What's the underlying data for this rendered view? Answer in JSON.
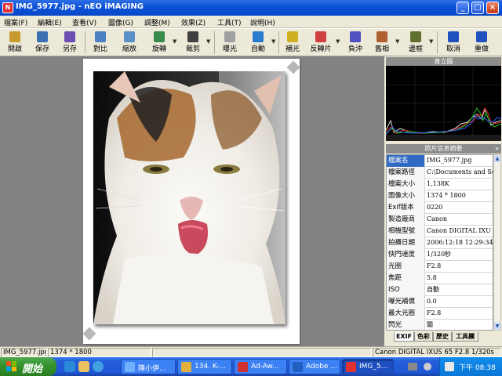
{
  "window": {
    "title": "IMG_5977.jpg - nEO iMAGING",
    "app_icon": "N"
  },
  "menu": [
    {
      "label": "檔案(F)"
    },
    {
      "label": "編輯(E)"
    },
    {
      "label": "查看(V)"
    },
    {
      "label": "圖像(G)"
    },
    {
      "label": "調整(M)"
    },
    {
      "label": "效果(Z)"
    },
    {
      "label": "工具(T)"
    },
    {
      "label": "說明(H)"
    }
  ],
  "toolbar": [
    {
      "label": "開啟",
      "icon": "open-folder-icon",
      "color": "#c89b2e"
    },
    {
      "label": "保存",
      "icon": "save-disk-icon",
      "color": "#3a6fb0"
    },
    {
      "label": "另存",
      "icon": "save-as-icon",
      "color": "#6a4fb0"
    },
    {
      "label": "對比",
      "icon": "compare-icon",
      "color": "#4a80c0"
    },
    {
      "label": "縮放",
      "icon": "resize-icon",
      "color": "#5a90c8"
    },
    {
      "label": "旋轉",
      "icon": "rotate-icon",
      "color": "#3a8a4a"
    },
    {
      "label": "裁剪",
      "icon": "crop-icon",
      "color": "#404040"
    },
    {
      "label": "曝光",
      "icon": "exposure-icon",
      "color": "#a0a0a0"
    },
    {
      "label": "自動",
      "icon": "auto-fix-icon",
      "color": "#2a7ad0"
    },
    {
      "label": "補光",
      "icon": "fill-light-icon",
      "color": "#d0b020"
    },
    {
      "label": "反轉片",
      "icon": "slide-film-icon",
      "color": "#d04040"
    },
    {
      "label": "負沖",
      "icon": "cross-process-icon",
      "color": "#5050c0"
    },
    {
      "label": "舊相",
      "icon": "old-photo-icon",
      "color": "#b06030"
    },
    {
      "label": "邊框",
      "icon": "frame-icon",
      "color": "#607030"
    },
    {
      "label": "取消",
      "icon": "undo-icon",
      "color": "#2050c0"
    },
    {
      "label": "重做",
      "icon": "redo-icon",
      "color": "#2050c0"
    }
  ],
  "panel": {
    "histogram_title": "直立圖",
    "info_title": "照片信息摘要",
    "rows": [
      {
        "key": "檔案名",
        "value": "IMG_5977.jpg"
      },
      {
        "key": "檔案路徑",
        "value": "C:\\Documents and Set"
      },
      {
        "key": "檔案大小",
        "value": "1,138K"
      },
      {
        "key": "圖像大小",
        "value": "1374 * 1800"
      },
      {
        "key": "Exif版本",
        "value": "0220"
      },
      {
        "key": "製造廠商",
        "value": "Canon"
      },
      {
        "key": "相機型號",
        "value": "Canon DIGITAL IXU"
      },
      {
        "key": "拍攝日期",
        "value": "2006:12:18 12:29:34"
      },
      {
        "key": "快門速度",
        "value": "1/320秒"
      },
      {
        "key": "光圈",
        "value": "F2.8"
      },
      {
        "key": "焦距",
        "value": "5.8"
      },
      {
        "key": "ISO",
        "value": "自動"
      },
      {
        "key": "曝光補償",
        "value": "0.0"
      },
      {
        "key": "最大光圈",
        "value": "F2.8"
      },
      {
        "key": "閃光",
        "value": "關"
      }
    ],
    "tabs": [
      {
        "label": "EXIF"
      },
      {
        "label": "色彩"
      },
      {
        "label": "歷史"
      },
      {
        "label": "工具欄"
      }
    ]
  },
  "status": {
    "filename": "IMG_5977.jpg",
    "dimensions": "1374 * 1800",
    "camera_info": "Canon DIGITAL IXUS 65 F2.8 1/320s"
  },
  "taskbar": {
    "start_label": "開始",
    "tasks": [
      {
        "label": "陳小伊..."
      },
      {
        "label": "134. K-..."
      },
      {
        "label": "Ad-Aw..."
      },
      {
        "label": "Adobe ..."
      },
      {
        "label": "IMG_5..."
      }
    ],
    "clock": "下午 08:38"
  }
}
